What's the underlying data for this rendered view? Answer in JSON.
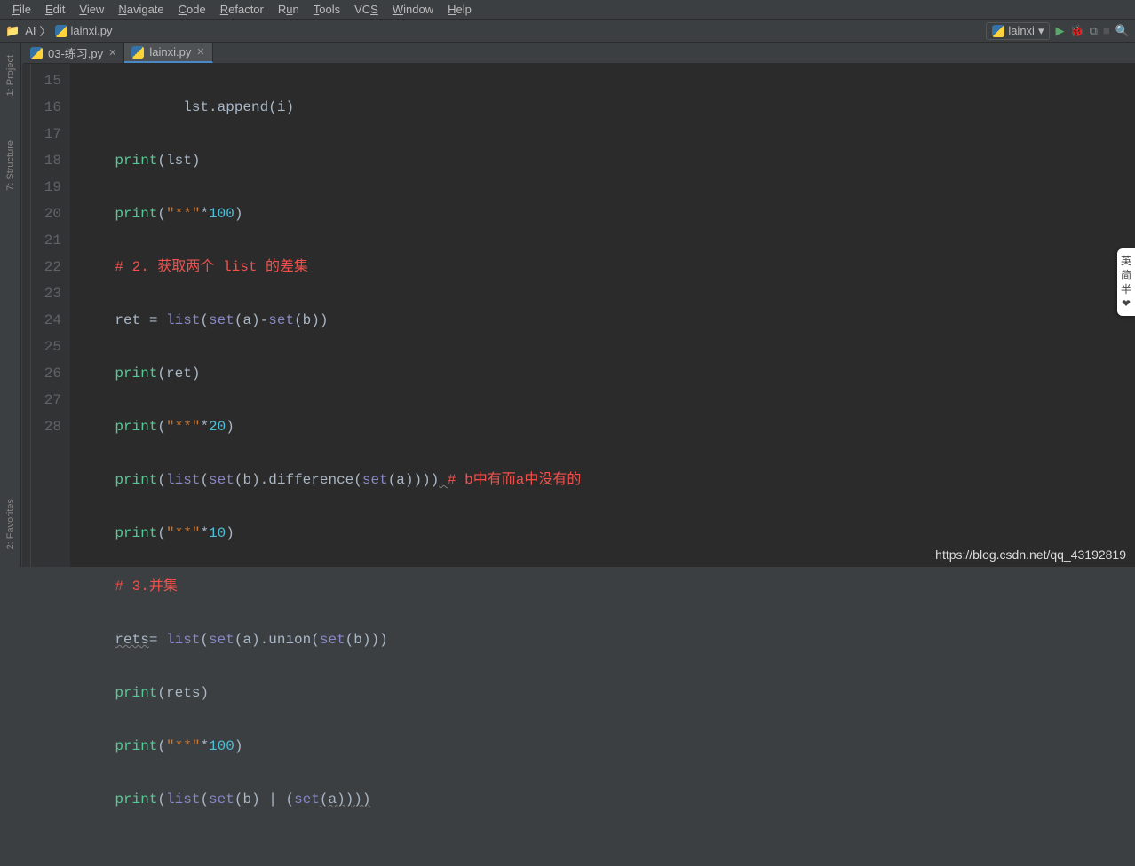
{
  "menu": [
    "File",
    "Edit",
    "View",
    "Navigate",
    "Code",
    "Refactor",
    "Run",
    "Tools",
    "VCS",
    "Window",
    "Help"
  ],
  "breadcrumb": {
    "folder": "AI",
    "file": "lainxi.py"
  },
  "runconfig": {
    "name": "lainxi"
  },
  "tabs": [
    {
      "label": "03-练习.py",
      "active": false
    },
    {
      "label": "lainxi.py",
      "active": true
    }
  ],
  "sidebar": {
    "project": "1: Project",
    "structure": "7: Structure",
    "favorites": "2: Favorites"
  },
  "ime": [
    "英",
    "简",
    "半",
    "❤"
  ],
  "watermark": "https://blog.csdn.net/qq_43192819",
  "gutter": [
    "15",
    "16",
    "17",
    "18",
    "19",
    "20",
    "21",
    "22",
    "23",
    "24",
    "25",
    "26",
    "27",
    "28"
  ],
  "code": {
    "l15a": "lst.append(i)",
    "l16_fn": "print",
    "l16_rest": "(lst)",
    "l17_fn": "print",
    "l17_s": "\"**\"",
    "l17_n": "100",
    "l18": "# 2. 获取两个 list 的差集",
    "l19_ret": "ret = ",
    "l19_list": "list",
    "l19_set1": "set",
    "l19_a": "(a)",
    "l19_minus": "-",
    "l19_set2": "set",
    "l19_b": "(b))",
    "l20_fn": "print",
    "l20_rest": "(ret)",
    "l21_fn": "print",
    "l21_s": "\"**\"",
    "l21_n": "20",
    "l22_fn": "print",
    "l22_list": "list",
    "l22_set1": "set",
    "l22_bd": "(b).difference(",
    "l22_set2": "set",
    "l22_a": "(a))))",
    "l22_c": "# b中有而a中没有的",
    "l23_fn": "print",
    "l23_s": "\"**\"",
    "l23_n": "10",
    "l24": "# 3.并集",
    "l25_rets": "rets",
    "l25_eq": "= ",
    "l25_list": "list",
    "l25_set1": "set",
    "l25_au": "(a).union(",
    "l25_set2": "set",
    "l25_b": "(b)))",
    "l26_fn": "print",
    "l26_rest": "(rets)",
    "l27_fn": "print",
    "l27_s": "\"**\"",
    "l27_n": "100",
    "l28_fn": "print",
    "l28_list": "list",
    "l28_set1": "set",
    "l28_mid": "(b) | (",
    "l28_set2": "set",
    "l28_end": "(a))))"
  }
}
